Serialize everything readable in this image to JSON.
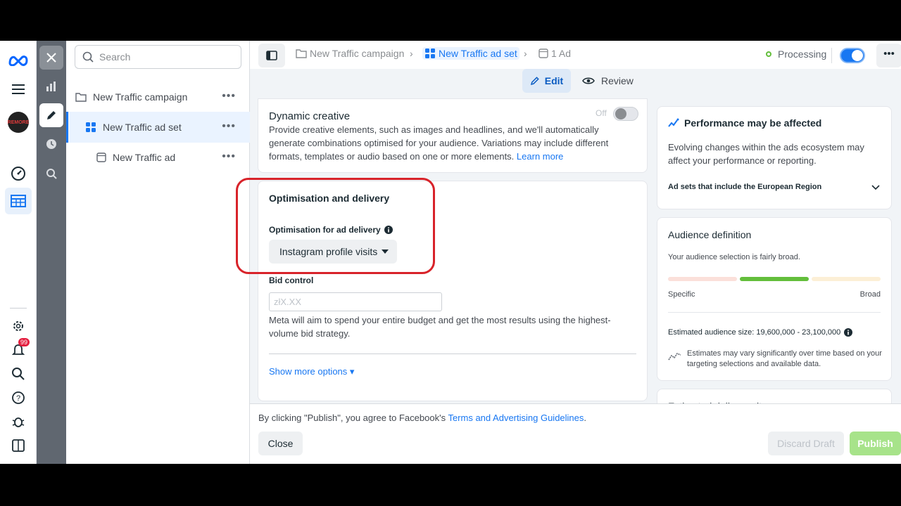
{
  "rail": {
    "notification_badge": "99",
    "brand_label": "REMORE"
  },
  "tree": {
    "search_placeholder": "Search",
    "campaign": "New Traffic campaign",
    "ad_set": "New Traffic ad set",
    "ad": "New Traffic ad"
  },
  "topbar": {
    "crumb_campaign": "New Traffic campaign",
    "crumb_adset": "New Traffic ad set",
    "crumb_ad": "1 Ad",
    "status": "Processing"
  },
  "mode": {
    "edit": "Edit",
    "review": "Review"
  },
  "dynamic_creative": {
    "title": "Dynamic creative",
    "toggle_label": "Off",
    "description": "Provide creative elements, such as images and headlines, and we'll automatically generate combinations optimised for your audience. Variations may include different formats, templates or audio based on one or more elements. ",
    "learn_more": "Learn more"
  },
  "optimisation": {
    "title": "Optimisation and delivery",
    "field_label": "Optimisation for ad delivery",
    "selected_value": "Instagram profile visits",
    "bid_label": "Bid control",
    "bid_placeholder": "złX.XX",
    "bid_help": "Meta will aim to spend your entire budget and get the most results using the highest-volume bid strategy.",
    "more_options": "Show more options ▾"
  },
  "footer": {
    "notice_prefix": "By clicking \"Publish\", you agree to Facebook's ",
    "notice_link": "Terms and Advertising Guidelines",
    "notice_suffix": ".",
    "close": "Close",
    "discard": "Discard Draft",
    "publish": "Publish"
  },
  "performance": {
    "title": "Performance may be affected",
    "body": "Evolving changes within the ads ecosystem may affect your performance or reporting.",
    "expand_label": "Ad sets that include the European Region"
  },
  "audience": {
    "title": "Audience definition",
    "summary": "Your audience selection is fairly broad.",
    "specific": "Specific",
    "broad": "Broad",
    "breadth_level": "fairly broad",
    "size": "Estimated audience size: 19,600,000 - 23,100,000",
    "note": "Estimates may vary significantly over time based on your targeting selections and available data."
  },
  "daily_results": {
    "title": "Estimated daily results"
  },
  "colors": {
    "accent": "#1877f2",
    "highlight_box": "#d8232a",
    "meter_active": "#63be3b",
    "publish_disabled": "#a7e38a"
  }
}
